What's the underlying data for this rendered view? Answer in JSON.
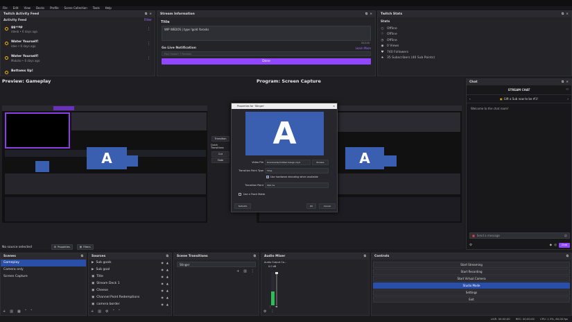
{
  "menu": [
    "File",
    "Edit",
    "View",
    "Docks",
    "Profile",
    "Scene Collection",
    "Tools",
    "Help"
  ],
  "activity_feed": {
    "title": "Twitch Activity Feed",
    "sub_title": "Activity Feed",
    "filter_label": "Filter",
    "items": [
      {
        "title": "gg+np",
        "sub": "ideeb • 6 days ago"
      },
      {
        "title": "Water Yourself!",
        "sub": "idee • 6 days ago"
      },
      {
        "title": "Water Yourself!",
        "sub": "Makoto • 6 days ago"
      },
      {
        "title": "Bottoms Up!",
        "sub": ""
      }
    ]
  },
  "stream_info": {
    "header": "Stream Information",
    "title_label": "Title",
    "title_value": "WIP WEDOS | type !gold !brosks",
    "char_count": "32/140",
    "go_live_label": "Go Live Notification",
    "learn_more": "Learn More",
    "notification_value": "Paul Fowler! ? Reveals",
    "done_label": "Done"
  },
  "stats": {
    "header": "Twitch Stats",
    "sub_title": "Stats",
    "rows": [
      {
        "icon": "user-icon",
        "glyph": "○",
        "text": "Offline"
      },
      {
        "icon": "heart-icon",
        "glyph": "♡",
        "text": "Offline"
      },
      {
        "icon": "clock-icon",
        "glyph": "◷",
        "text": "Offline"
      },
      {
        "icon": "eye-icon",
        "glyph": "◉",
        "text": "0 Views"
      },
      {
        "icon": "heart-filled-icon",
        "glyph": "♥",
        "text": "740 Followers"
      },
      {
        "icon": "star-icon",
        "glyph": "★",
        "text": "35 Subscribers (40 Sub Points)"
      }
    ]
  },
  "preview": {
    "label": "Preview: Gameplay"
  },
  "program": {
    "label": "Program: Screen Capture"
  },
  "studio": {
    "transition_label": "Transition",
    "quick_transitions": "Quick Transitions",
    "cut_label": "Cut",
    "fade_label": "Fade"
  },
  "dialog": {
    "title": "Properties for 'Stinger'",
    "video_file_label": "Video File",
    "video_file_value": "Downloads/Untitled design.mp4",
    "browse_label": "Browse",
    "point_type_label": "Transition Point Type",
    "point_type_value": "Time",
    "hw_decode_label": "Use hardware decoding when available",
    "transition_point_label": "Transition Point",
    "transition_point_value": "500 ms",
    "track_matte_label": "Use a Track Matte",
    "defaults_label": "Defaults",
    "ok_label": "OK",
    "cancel_label": "Cancel",
    "preview_letter": "A"
  },
  "chat": {
    "header": "Chat",
    "stream_chat": "STREAM CHAT",
    "gift_text": "Gift a Sub now to be #1!",
    "welcome": "Welcome to the chat room!",
    "send_placeholder": "Send a message",
    "chat_button": "Chat"
  },
  "status_bar": {
    "no_source": "No source selected",
    "properties": "Properties",
    "filters": "Filters",
    "live": "LIVE: 00:00:00",
    "rec": "REC: 00:00:00",
    "cpu": "CPU: 1.3%, 60.00 fps"
  },
  "scenes": {
    "header": "Scenes",
    "items": [
      "Gameplay",
      "Camera only",
      "Screen Capture"
    ],
    "selected": 0
  },
  "sources": {
    "header": "Sources",
    "items": [
      "Sub goals",
      "Sub goal",
      "Title",
      "Stream Deck 1",
      "Cheese",
      "Channel Point Redemptions",
      "camera border"
    ]
  },
  "transitions": {
    "header": "Scene Transitions",
    "value": "Stinger"
  },
  "mixer": {
    "header": "Audio Mixer",
    "channel": "Audio Output Ca...",
    "db": "0.0 dB"
  },
  "controls": {
    "header": "Controls",
    "buttons": [
      {
        "label": "Start Streaming",
        "active": false
      },
      {
        "label": "Start Recording",
        "active": false
      },
      {
        "label": "Start Virtual Camera",
        "active": false
      },
      {
        "label": "Studio Mode",
        "active": true
      },
      {
        "label": "Settings",
        "active": false
      },
      {
        "label": "Exit",
        "active": false
      }
    ]
  },
  "colors": {
    "accent": "#9147ff",
    "selection": "#2a4fa8",
    "preview_blue": "#3b5fb0"
  }
}
